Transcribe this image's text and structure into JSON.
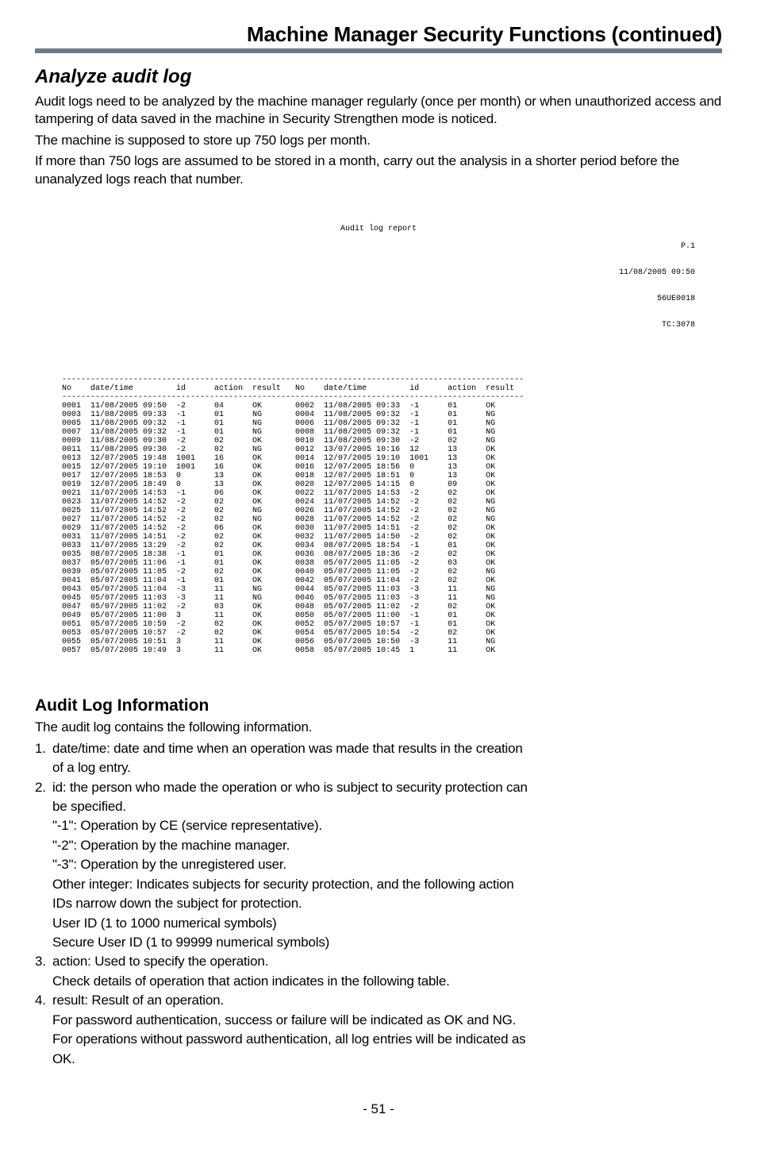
{
  "header": {
    "title": "Machine Manager Security Functions (continued)"
  },
  "section": {
    "heading": "Analyze audit log",
    "para1": "Audit logs need to be analyzed by the machine manager regularly (once per month) or when unauthorized access and tampering of data saved in the machine in Security Strengthen mode is noticed.",
    "para2": "The machine is supposed to store up 750 logs per month.",
    "para3": "If more than 750 logs are assumed to be stored in a month, carry out the analysis in a shorter period before the unanalyzed logs reach that number."
  },
  "report": {
    "title": "Audit log report",
    "meta": [
      "P.1",
      "11/08/2005 09:50",
      "56UE0018",
      "TC:3078"
    ],
    "columns": [
      "No",
      "date/time",
      "id",
      "action",
      "result",
      "No",
      "date/time",
      "id",
      "action",
      "result"
    ],
    "rows": [
      [
        "0001",
        "11/08/2005 09:50",
        "-2",
        "04",
        "OK",
        "0002",
        "11/08/2005 09:33",
        "-1",
        "01",
        "OK"
      ],
      [
        "0003",
        "11/08/2005 09:33",
        "-1",
        "01",
        "NG",
        "0004",
        "11/08/2005 09:32",
        "-1",
        "01",
        "NG"
      ],
      [
        "0005",
        "11/08/2005 09:32",
        "-1",
        "01",
        "NG",
        "0006",
        "11/08/2005 09:32",
        "-1",
        "01",
        "NG"
      ],
      [
        "0007",
        "11/08/2005 09:32",
        "-1",
        "01",
        "NG",
        "0008",
        "11/08/2005 09:32",
        "-1",
        "01",
        "NG"
      ],
      [
        "0009",
        "11/08/2005 09:30",
        "-2",
        "02",
        "OK",
        "0010",
        "11/08/2005 09:30",
        "-2",
        "02",
        "NG"
      ],
      [
        "0011",
        "11/08/2005 09:30",
        "-2",
        "02",
        "NG",
        "0012",
        "13/07/2005 10:16",
        "12",
        "13",
        "OK"
      ],
      [
        "0013",
        "12/07/2005 19:48",
        "1001",
        "16",
        "OK",
        "0014",
        "12/07/2005 19:10",
        "1001",
        "13",
        "OK"
      ],
      [
        "0015",
        "12/07/2005 19:10",
        "1001",
        "16",
        "OK",
        "0016",
        "12/07/2005 18:56",
        "0",
        "13",
        "OK"
      ],
      [
        "0017",
        "12/07/2005 18:53",
        "0",
        "13",
        "OK",
        "0018",
        "12/07/2005 18:51",
        "0",
        "13",
        "OK"
      ],
      [
        "0019",
        "12/07/2005 18:49",
        "0",
        "13",
        "OK",
        "0020",
        "12/07/2005 14:15",
        "0",
        "09",
        "OK"
      ],
      [
        "0021",
        "11/07/2005 14:53",
        "-1",
        "06",
        "OK",
        "0022",
        "11/07/2005 14:53",
        "-2",
        "02",
        "OK"
      ],
      [
        "0023",
        "11/07/2005 14:52",
        "-2",
        "02",
        "OK",
        "0024",
        "11/07/2005 14:52",
        "-2",
        "02",
        "NG"
      ],
      [
        "0025",
        "11/07/2005 14:52",
        "-2",
        "02",
        "NG",
        "0026",
        "11/07/2005 14:52",
        "-2",
        "02",
        "NG"
      ],
      [
        "0027",
        "11/07/2005 14:52",
        "-2",
        "02",
        "NG",
        "0028",
        "11/07/2005 14:52",
        "-2",
        "02",
        "NG"
      ],
      [
        "0029",
        "11/07/2005 14:52",
        "-2",
        "06",
        "OK",
        "0030",
        "11/07/2005 14:51",
        "-2",
        "02",
        "OK"
      ],
      [
        "0031",
        "11/07/2005 14:51",
        "-2",
        "02",
        "OK",
        "0032",
        "11/07/2005 14:50",
        "-2",
        "02",
        "OK"
      ],
      [
        "0033",
        "11/07/2005 13:29",
        "-2",
        "02",
        "OK",
        "0034",
        "08/07/2005 18:54",
        "-1",
        "01",
        "OK"
      ],
      [
        "0035",
        "08/07/2005 18:38",
        "-1",
        "01",
        "OK",
        "0036",
        "08/07/2005 18:36",
        "-2",
        "02",
        "OK"
      ],
      [
        "0037",
        "05/07/2005 11:06",
        "-1",
        "01",
        "OK",
        "0038",
        "05/07/2005 11:05",
        "-2",
        "03",
        "OK"
      ],
      [
        "0039",
        "05/07/2005 11:05",
        "-2",
        "02",
        "OK",
        "0040",
        "05/07/2005 11:05",
        "-2",
        "02",
        "NG"
      ],
      [
        "0041",
        "05/07/2005 11:04",
        "-1",
        "01",
        "OK",
        "0042",
        "05/07/2005 11:04",
        "-2",
        "02",
        "OK"
      ],
      [
        "0043",
        "05/07/2005 11:04",
        "-3",
        "11",
        "NG",
        "0044",
        "05/07/2005 11:03",
        "-3",
        "11",
        "NG"
      ],
      [
        "0045",
        "05/07/2005 11:03",
        "-3",
        "11",
        "NG",
        "0046",
        "05/07/2005 11:03",
        "-3",
        "11",
        "NG"
      ],
      [
        "0047",
        "05/07/2005 11:02",
        "-2",
        "03",
        "OK",
        "0048",
        "05/07/2005 11:02",
        "-2",
        "02",
        "OK"
      ],
      [
        "0049",
        "05/07/2005 11:00",
        "3",
        "11",
        "OK",
        "0050",
        "05/07/2005 11:00",
        "-1",
        "01",
        "OK"
      ],
      [
        "0051",
        "05/07/2005 10:59",
        "-2",
        "02",
        "OK",
        "0052",
        "05/07/2005 10:57",
        "-1",
        "01",
        "OK"
      ],
      [
        "0053",
        "05/07/2005 10:57",
        "-2",
        "02",
        "OK",
        "0054",
        "05/07/2005 10:54",
        "-2",
        "02",
        "OK"
      ],
      [
        "0055",
        "05/07/2005 10:51",
        "3",
        "11",
        "OK",
        "0056",
        "05/07/2005 10:50",
        "-3",
        "11",
        "NG"
      ],
      [
        "0057",
        "05/07/2005 10:49",
        "3",
        "11",
        "OK",
        "0058",
        "05/07/2005 10:45",
        "1",
        "11",
        "OK"
      ]
    ]
  },
  "audit_info": {
    "heading": "Audit Log Information",
    "intro": "The audit log contains the following information.",
    "item1_line1": "date/time: date and time when an operation was made that results in the creation",
    "item1_line2": "of a log entry.",
    "item2_line1": "id: the person who made the operation or who is subject to security protection can",
    "item2_line2": "be specified.",
    "item2_sub1": "\"-1\": Operation by CE (service representative).",
    "item2_sub2": "\"-2\": Operation by the machine manager.",
    "item2_sub3": "\"-3\": Operation by the unregistered user.",
    "item2_sub4a": "Other integer: Indicates subjects for security protection, and the following action",
    "item2_sub4b": "IDs narrow down the subject for protection.",
    "item2_sub5": "User ID (1 to 1000 numerical symbols)",
    "item2_sub6": "Secure User ID (1 to 99999 numerical symbols)",
    "item3_line1": "action: Used to specify the operation.",
    "item3_line2": "Check details of operation that action indicates in the following table.",
    "item4_line1": "result: Result of an operation.",
    "item4_line2": "For password authentication, success or failure will be indicated as OK and NG.",
    "item4_line3": "For operations without password authentication, all log entries will be indicated as",
    "item4_line4": "OK."
  },
  "page_number": "- 51 -"
}
